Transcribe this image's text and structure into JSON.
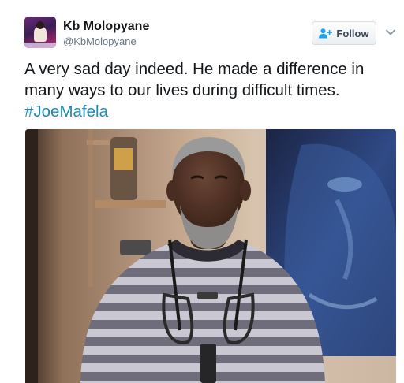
{
  "tweet": {
    "author": {
      "display_name": "Kb Molopyane",
      "handle": "@KbMolopyane",
      "avatar_icon": "profile-photo"
    },
    "follow_button": {
      "label": "Follow",
      "icon": "add-user-icon"
    },
    "menu_icon": "chevron-down-icon",
    "text_lines": [
      "A very sad day indeed. He made a difference in",
      "many ways to our lives during difficult times."
    ],
    "hashtag": "#JoeMafela",
    "media": {
      "type": "photo"
    }
  },
  "colors": {
    "text": "#14171a",
    "secondary": "#657786",
    "link": "#1b8ab8",
    "button_border": "#d8dde2"
  }
}
